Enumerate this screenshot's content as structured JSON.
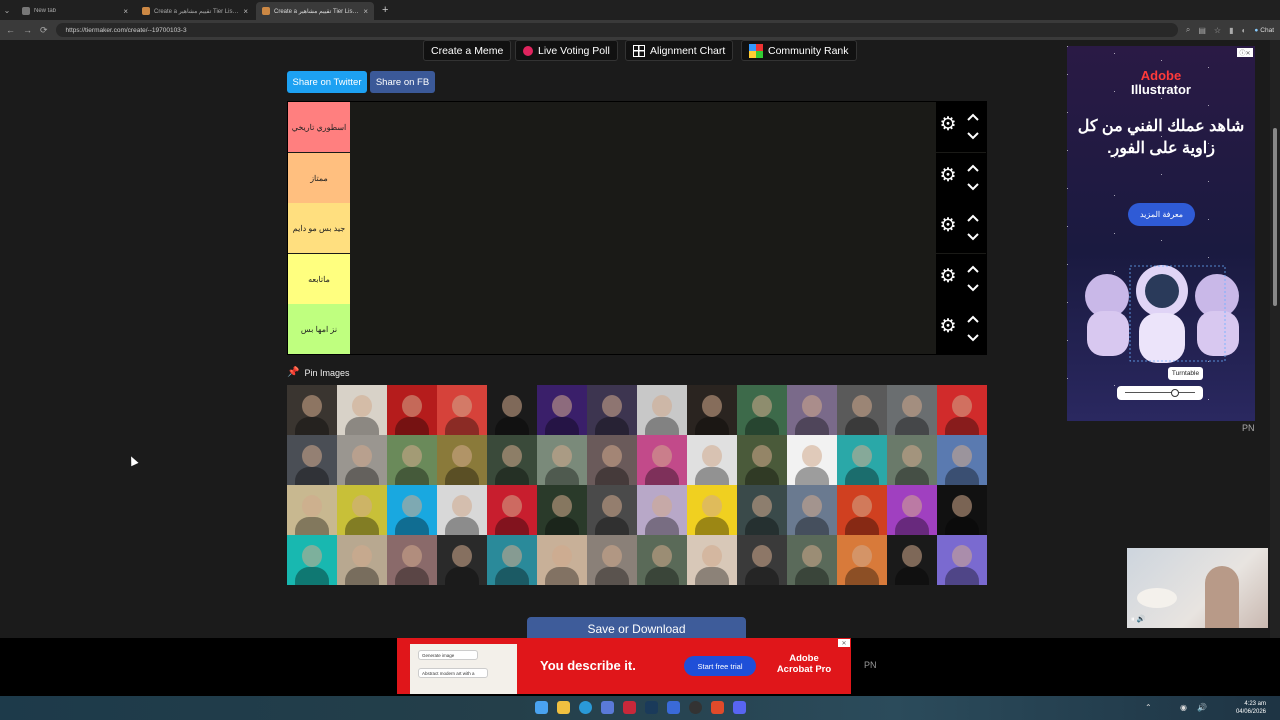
{
  "browser": {
    "tabs": [
      {
        "title": "New tab",
        "active": false
      },
      {
        "title": "Create a تقييم مشاهير Tier List - Tie",
        "active": false
      },
      {
        "title": "Create a تقييم مشاهير Tier List - Tie",
        "active": true
      }
    ],
    "new_tab_glyph": "+",
    "close_glyph": "×",
    "url": "https://tiermaker.com/create/--19700103-3",
    "chat_label": "Chat"
  },
  "toolbar": {
    "create_meme": "Create a Meme",
    "live_voting": "Live Voting Poll",
    "alignment_chart": "Alignment Chart",
    "community_rank": "Community Rank"
  },
  "share": {
    "twitter": "Share on Twitter",
    "fb": "Share on FB"
  },
  "tiers": [
    {
      "label": "اسطوري تاريخي",
      "color": "#ff7f7f"
    },
    {
      "label": "ممتاز",
      "color": "#ffbf7f"
    },
    {
      "label": "جيد بس مو دايم",
      "color": "#ffdf7f"
    },
    {
      "label": "ماتابعه",
      "color": "#ffff7f"
    },
    {
      "label": "نز امها بس",
      "color": "#bfff7f"
    }
  ],
  "pin_images_label": "Pin Images",
  "image_tile_colors": [
    "#3a3530",
    "#d8d2c8",
    "#b51c1c",
    "#d6423a",
    "#1b1b1b",
    "#3a1f6a",
    "#3d3550",
    "#c8c8c8",
    "#2a2420",
    "#3d6a4a",
    "#7a6a8a",
    "#5a5a5a",
    "#6a6e70",
    "#d12b2b",
    "#4a4e55",
    "#9a9690",
    "#6a8a5a",
    "#8a7a3a",
    "#3a4a3a",
    "#7a8a7a",
    "#6a5a5a",
    "#c24a8a",
    "#e0e0e0",
    "#4a5a3a",
    "#f2f2f2",
    "#2aa8a8",
    "#6a7a6a",
    "#5a7ab0",
    "#c8b890",
    "#c8c038",
    "#19a8e0",
    "#d8d8d8",
    "#c81e2e",
    "#2a3a2a",
    "#4a4a4a",
    "#b8a8c8",
    "#f0d020",
    "#3a4a4a",
    "#6a7a90",
    "#d04020",
    "#a040c0",
    "#111111",
    "#18b8b0",
    "#b8a890",
    "#8a6a6a",
    "#2a2a2a",
    "#2a8a9a",
    "#c8b098",
    "#8a8078",
    "#5a6a58",
    "#d8c8b8",
    "#3a3a3a",
    "#5a6a5a",
    "#d87a3a",
    "#1a1a1a",
    "#7a6ad0"
  ],
  "save_button": "Save or Download",
  "ad_right": {
    "brand_line1": "Adobe",
    "brand_line2": "Illustrator",
    "headline": "شاهد عملك الفني من كل زاوية على الفور.",
    "cta": "معرفة المزيد",
    "tooltip": "Turntable",
    "badge": "PN"
  },
  "ad_bottom": {
    "text": "You describe it.",
    "cta": "Start free trial",
    "brand_line1": "Adobe",
    "brand_line2": "Acrobat Pro",
    "mock_line1": "Generate image",
    "mock_line2": "Abstract modern art with a",
    "badge": "PN"
  },
  "taskbar": {
    "time": "4:23 am",
    "date": "04/06/2026"
  }
}
